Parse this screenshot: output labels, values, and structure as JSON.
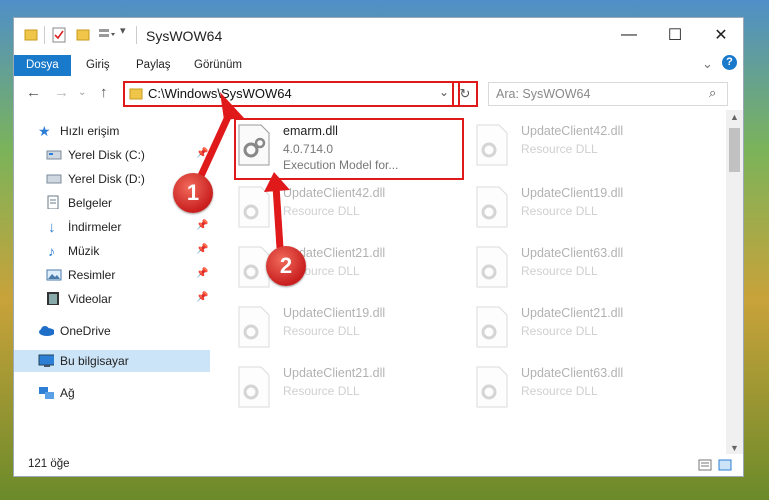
{
  "window": {
    "title": "SysWOW64",
    "controls": {
      "minimize": "—",
      "maximize": "☐",
      "close": "✕"
    }
  },
  "ribbon": {
    "tabs": [
      {
        "label": "Dosya",
        "active": true
      },
      {
        "label": "Giriş"
      },
      {
        "label": "Paylaş"
      },
      {
        "label": "Görünüm"
      }
    ],
    "help": "?"
  },
  "address": {
    "path": "C:\\Windows\\SysWOW64",
    "search_placeholder": "Ara: SysWOW64"
  },
  "sidebar": {
    "items": [
      {
        "label": "Hızlı erişim",
        "icon": "star-icon"
      },
      {
        "label": "Yerel Disk (C:)",
        "icon": "drive-icon",
        "pinned": true
      },
      {
        "label": "Yerel Disk (D:)",
        "icon": "drive-icon"
      },
      {
        "label": "Belgeler",
        "icon": "documents-icon",
        "pinned": true
      },
      {
        "label": "İndirmeler",
        "icon": "download-icon",
        "pinned": true
      },
      {
        "label": "Müzik",
        "icon": "music-icon",
        "pinned": true
      },
      {
        "label": "Resimler",
        "icon": "pictures-icon",
        "pinned": true
      },
      {
        "label": "Videolar",
        "icon": "videos-icon",
        "pinned": true
      },
      {
        "label": "OneDrive",
        "icon": "cloud-icon"
      },
      {
        "label": "Bu bilgisayar",
        "icon": "computer-icon",
        "selected": true
      },
      {
        "label": "Ağ",
        "icon": "network-icon"
      }
    ]
  },
  "files": {
    "highlighted": {
      "name": "emarm.dll",
      "version": "4.0.714.0",
      "description": "Execution Model for..."
    },
    "col1": [
      {
        "name": "UpdateClient42.dll",
        "type": "Resource DLL"
      },
      {
        "name": "UpdateClient21.dll",
        "type": "Resource DLL"
      },
      {
        "name": "UpdateClient19.dll",
        "type": "Resource DLL"
      },
      {
        "name": "UpdateClient21.dll",
        "type": "Resource DLL"
      }
    ],
    "col2": [
      {
        "name": "UpdateClient42.dll",
        "type": "Resource DLL"
      },
      {
        "name": "UpdateClient19.dll",
        "type": "Resource DLL"
      },
      {
        "name": "UpdateClient63.dll",
        "type": "Resource DLL"
      },
      {
        "name": "UpdateClient21.dll",
        "type": "Resource DLL"
      },
      {
        "name": "UpdateClient63.dll",
        "type": "Resource DLL"
      }
    ]
  },
  "status": {
    "count": "121 öğe"
  },
  "annotations": {
    "step1": "1",
    "step2": "2",
    "color": "#e0191b"
  }
}
